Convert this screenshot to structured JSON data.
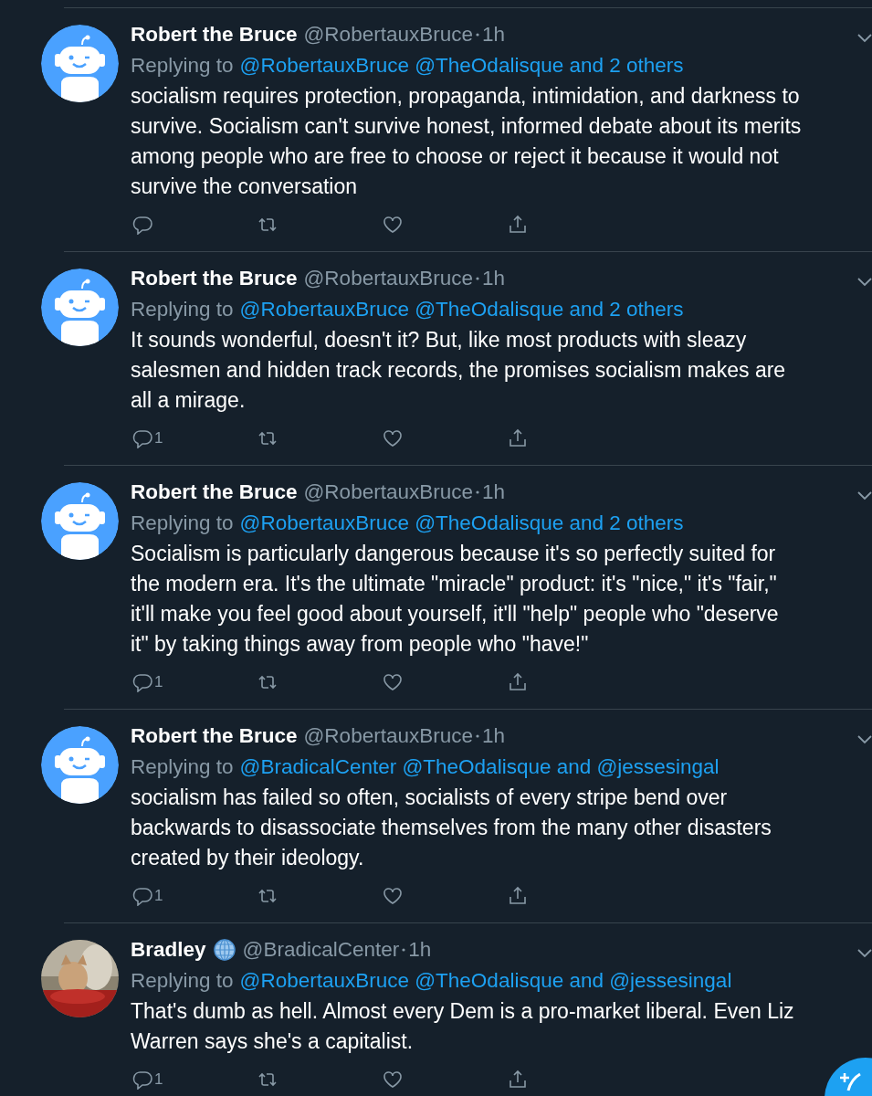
{
  "tweets": [
    {
      "avatar": {
        "kind": "robot"
      },
      "name": "Robert the Bruce",
      "handle": "@RobertauxBruce",
      "time": "1h",
      "reply_prefix": "Replying to",
      "reply_targets": "@RobertauxBruce @TheOdalisque and 2 others",
      "text": "socialism requires protection, propaganda, intimidation, and darkness to survive. Socialism can't survive honest, informed debate about its merits among people who are free to choose or reject it because it would not survive the conversation"
    },
    {
      "avatar": {
        "kind": "robot"
      },
      "name": "Robert the Bruce",
      "handle": "@RobertauxBruce",
      "time": "1h",
      "reply_prefix": "Replying to",
      "reply_targets": "@RobertauxBruce @TheOdalisque and 2 others",
      "text": "It sounds wonderful, doesn't it? But, like most products with sleazy salesmen and hidden track records, the promises socialism makes are all a mirage.",
      "reply_count": "1"
    },
    {
      "avatar": {
        "kind": "robot"
      },
      "name": "Robert the Bruce",
      "handle": "@RobertauxBruce",
      "time": "1h",
      "reply_prefix": "Replying to",
      "reply_targets": "@RobertauxBruce @TheOdalisque and 2 others",
      "text": "Socialism is particularly dangerous because it's so perfectly suited for the modern era. It's the ultimate \"miracle\" product: it's \"nice,\" it's \"fair,\" it'll make you feel good about yourself, it'll \"help\" people who \"deserve it\" by taking things away from people who \"have!\"",
      "reply_count": "1"
    },
    {
      "avatar": {
        "kind": "robot"
      },
      "name": "Robert the Bruce",
      "handle": "@RobertauxBruce",
      "time": "1h",
      "reply_prefix": "Replying to",
      "reply_targets": "@BradicalCenter @TheOdalisque and @jessesingal",
      "text": "socialism has failed so often, socialists of every stripe bend over backwards to disassociate themselves from the many other disasters created by their ideology.",
      "reply_count": "1"
    },
    {
      "name": "Bradley",
      "globe_badge": true,
      "handle": "@BradicalCenter",
      "time": "1h",
      "reply_prefix": "Replying to",
      "reply_targets": "@RobertauxBruce @TheOdalisque and @jessesingal",
      "text": "That's dumb as hell. Almost every Dem is a pro-market liberal. Even Liz Warren says she's a capitalist.",
      "reply_count": "1"
    }
  ]
}
